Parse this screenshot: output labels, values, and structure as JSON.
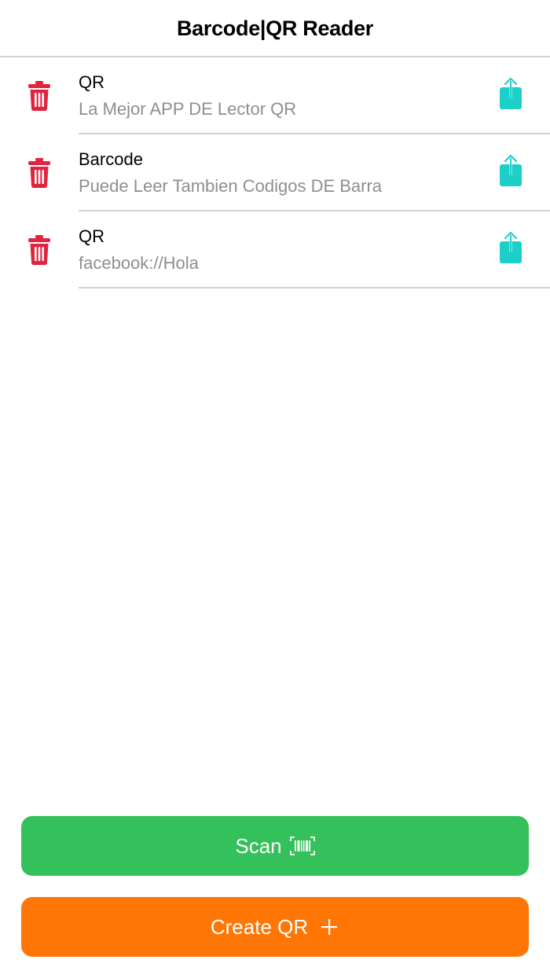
{
  "app": {
    "title": "Barcode|QR Reader"
  },
  "list": {
    "items": [
      {
        "title": "QR",
        "subtitle": "La Mejor APP DE Lector QR"
      },
      {
        "title": "Barcode",
        "subtitle": "Puede Leer Tambien Codigos DE Barra"
      },
      {
        "title": "QR",
        "subtitle": "facebook://Hola"
      }
    ],
    "row_icons": {
      "delete": "trash-icon",
      "share": "share-icon"
    }
  },
  "actions": {
    "scan_label": "Scan",
    "scan_icon": "barcode-icon",
    "create_label": "Create QR",
    "create_icon": "plus-icon"
  },
  "colors": {
    "scan_button": "#34c05a",
    "create_button": "#fd7606",
    "delete_icon": "#e0243f",
    "share_icon": "#1dcfc9",
    "subtitle_text": "#8e8e93",
    "divider": "#d1d1d6"
  }
}
